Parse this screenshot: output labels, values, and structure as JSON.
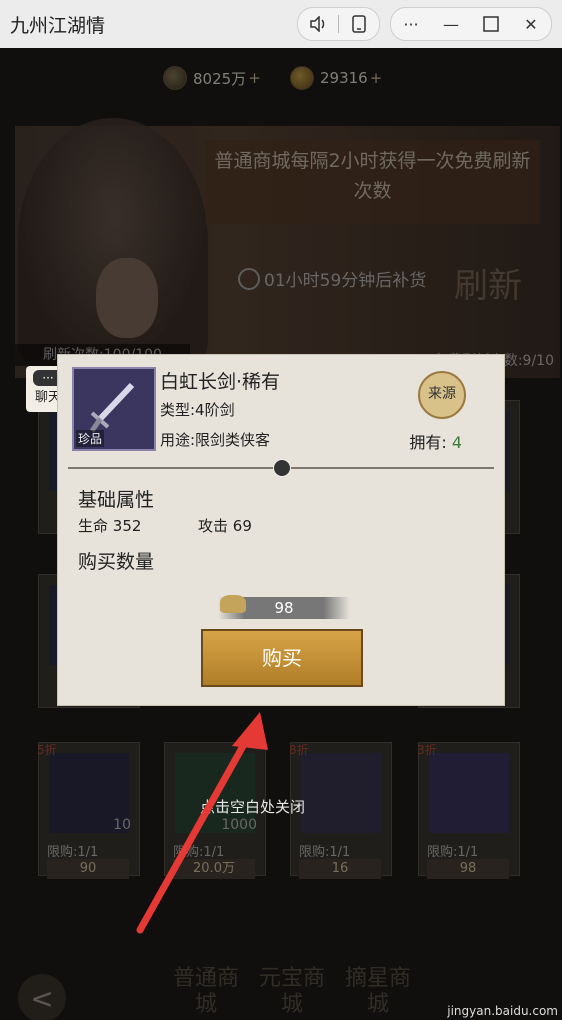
{
  "titlebar": {
    "title": "九州江湖情",
    "icons": [
      "speaker-icon",
      "phone-icon",
      "more-icon",
      "minimize-icon",
      "maximize-icon",
      "close-icon"
    ],
    "more_glyph": "···",
    "minimize_glyph": "—",
    "close_glyph": "✕"
  },
  "currency": {
    "copper": "8025万",
    "gold": "29316",
    "plus": "+"
  },
  "banner": {
    "notice": "普通商城每隔2小时获得一次免费刷新次数",
    "timer": "01小时59分钟后补货",
    "refresh_label": "刷新",
    "refresh_count": "刷新次数:100/100",
    "free_count": "免费刷新次数:9/10"
  },
  "chat": {
    "dots": "···",
    "label": "聊天"
  },
  "popup": {
    "item_name": "白虹长剑·稀有",
    "item_type": "类型:4阶剑",
    "item_use": "用途:限剑类侠客",
    "rarity": "珍品",
    "source_label": "来源",
    "own_label": "拥有:",
    "own_value": "4",
    "base_attr_title": "基础属性",
    "hp_label": "生命",
    "hp_value": "352",
    "atk_label": "攻击",
    "atk_value": "69",
    "buy_qty_title": "购买数量",
    "price": "98",
    "buy_label": "购买"
  },
  "close_hint": "点击空白处关闭",
  "items": [
    {
      "qty": "10",
      "limit": "限购:1/1",
      "price": "90",
      "discount": "5折"
    },
    {
      "qty": "1000",
      "limit": "限购:1/1",
      "price": "20.0万",
      "discount": ""
    },
    {
      "qty": "",
      "limit": "限购:1/1",
      "price": "16",
      "discount": "8折"
    },
    {
      "qty": "",
      "limit": "限购:1/1",
      "price": "98",
      "discount": "3折"
    }
  ],
  "bottom_tabs": [
    "普通商城",
    "元宝商城",
    "摘星商城"
  ],
  "back_glyph": "<",
  "watermark": "jingyan.baidu.com",
  "colors": {
    "accent_gold": "#d7a347",
    "popup_bg": "#e7e3db",
    "own_green": "#3e7b3e"
  }
}
